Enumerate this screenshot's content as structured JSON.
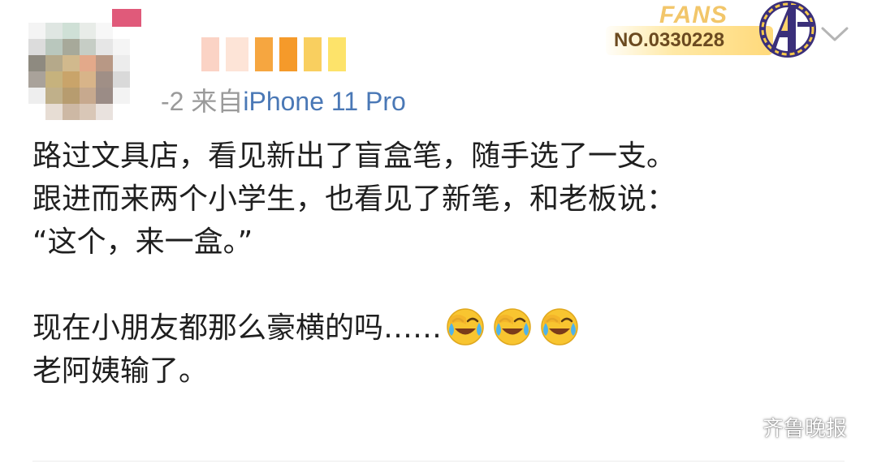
{
  "header": {
    "post_time": "-2",
    "source_prefix": "来自",
    "source_device": "iPhone 11 Pro"
  },
  "fans_badge": {
    "label": "FANS",
    "number": "NO.0330228"
  },
  "icons": {
    "avatar": "blurred-avatar",
    "fans_emblem": "avengers-a-emblem",
    "more": "chevron-down-icon",
    "emoji": "laugh-cry-emoji",
    "watermark": "wechat-icon"
  },
  "post": {
    "lines": [
      "路过文具店，看见新出了盲盒笔，随手选了一支。",
      "跟进而来两个小学生，也看见了新笔，和老板说：",
      "“这个，来一盒。”"
    ],
    "line4": "现在小朋友都那么豪横的吗……",
    "emoji_count": 3,
    "line5": "老阿姨输了。"
  },
  "watermark": {
    "text": "齐鲁晚报"
  },
  "colors": {
    "source_link": "#4a78b6",
    "meta_gray": "#9a9a9a",
    "fans_gold": "#f2c66a",
    "emoji_yellow": "#f8c530",
    "emoji_tear": "#4fb3ea"
  }
}
